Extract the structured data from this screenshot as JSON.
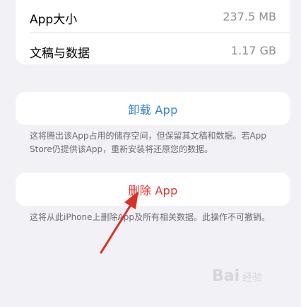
{
  "storage": {
    "app_size_label": "App大小",
    "app_size_value": "237.5 MB",
    "docs_label": "文稿与数据",
    "docs_value": "1.17 GB"
  },
  "offload": {
    "button_label": "卸载 App",
    "note": "这将腾出该App占用的储存空间，但保留其文稿和数据。若App Store仍提供该App，重新安装将还原您的数据。"
  },
  "delete": {
    "button_label": "删除 App",
    "note": "这将从此iPhone上删除App及所有相关数据。此操作不可撤销。"
  },
  "colors": {
    "link_blue": "#2f7fd8",
    "destructive_red": "#e8312c",
    "annotation_arrow": "#d9302a",
    "background": "#f2f2f6"
  },
  "watermark": {
    "brand": "Bai",
    "site": "经验"
  }
}
